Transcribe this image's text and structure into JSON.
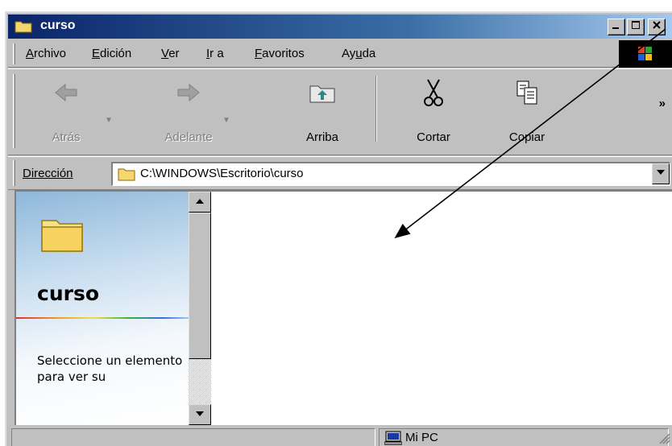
{
  "window": {
    "title": "curso"
  },
  "menu": {
    "items": [
      {
        "pre": "",
        "ul": "A",
        "post": "rchivo"
      },
      {
        "pre": "",
        "ul": "E",
        "post": "dición"
      },
      {
        "pre": "",
        "ul": "V",
        "post": "er"
      },
      {
        "pre": "",
        "ul": "I",
        "post": "r a"
      },
      {
        "pre": "",
        "ul": "F",
        "post": "avoritos"
      },
      {
        "pre": "Ay",
        "ul": "u",
        "post": "da"
      }
    ]
  },
  "toolbar": {
    "back_label": "Atrás",
    "forward_label": "Adelante",
    "up_label": "Arriba",
    "cut_label": "Cortar",
    "copy_label": "Copiar",
    "more_label": "»"
  },
  "address": {
    "label": "Dirección",
    "value": "C:\\WINDOWS\\Escritorio\\curso"
  },
  "leftpane": {
    "title": "curso",
    "description": "Seleccione un elemento para ver su"
  },
  "status": {
    "zone": "Mi PC"
  },
  "colors": {
    "titlebar_start": "#0a246a",
    "titlebar_end": "#a6caf0",
    "window_face": "#c0c0c0"
  }
}
